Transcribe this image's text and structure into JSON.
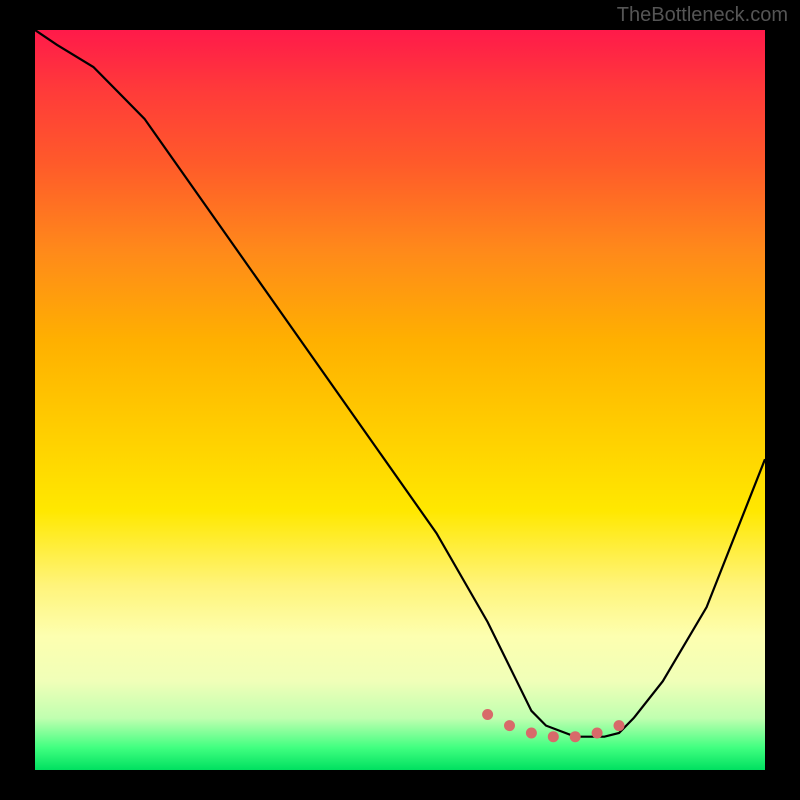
{
  "watermark": "TheBottleneck.com",
  "chart_data": {
    "type": "line",
    "title": "",
    "xlabel": "",
    "ylabel": "",
    "xlim": [
      0,
      100
    ],
    "ylim": [
      0,
      100
    ],
    "series": [
      {
        "name": "curve",
        "x": [
          0,
          3,
          8,
          15,
          25,
          35,
          45,
          55,
          62,
          66,
          68,
          70,
          74,
          78,
          80,
          82,
          86,
          92,
          100
        ],
        "values": [
          100,
          98,
          95,
          88,
          74,
          60,
          46,
          32,
          20,
          12,
          8,
          6,
          4.5,
          4.5,
          5,
          7,
          12,
          22,
          42
        ]
      },
      {
        "name": "highlight-dots",
        "x": [
          62,
          65,
          68,
          71,
          74,
          77,
          80
        ],
        "values": [
          7.5,
          6.0,
          5.0,
          4.5,
          4.5,
          5.0,
          6.0
        ]
      }
    ],
    "gradient_stops": [
      {
        "pos": 0,
        "color": "#ff1a4a"
      },
      {
        "pos": 18,
        "color": "#ff5a2a"
      },
      {
        "pos": 42,
        "color": "#ffd000"
      },
      {
        "pos": 75,
        "color": "#fff47a"
      },
      {
        "pos": 97,
        "color": "#40ff80"
      },
      {
        "pos": 100,
        "color": "#00e060"
      }
    ]
  }
}
